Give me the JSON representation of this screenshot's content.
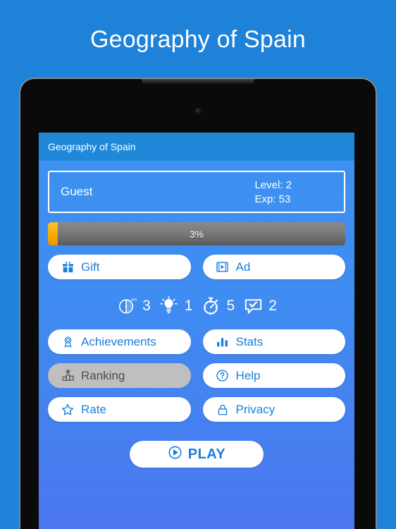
{
  "banner": {
    "title": "Geography of Spain"
  },
  "device": {
    "camera_icon": "camera-dot",
    "speaker_icon": "speaker-notch"
  },
  "app": {
    "appbar": {
      "title": "Geography of Spain"
    },
    "profile": {
      "name": "Guest",
      "level": "Level: 2",
      "exp": "Exp: 53"
    },
    "progress": {
      "label": "3%",
      "percent": 3,
      "fill_color": "#f5a800",
      "track_color": "#7a7a7a"
    },
    "rows": [
      {
        "buttons": [
          {
            "label": "Gift",
            "icon": "gift-icon",
            "disabled": false
          },
          {
            "label": "Ad",
            "icon": "video-ad-icon",
            "disabled": false
          }
        ]
      }
    ],
    "powerups": [
      {
        "icon": "fifty-fifty-icon",
        "count": "3"
      },
      {
        "icon": "lightbulb-icon",
        "count": "1"
      },
      {
        "icon": "stopwatch-icon",
        "count": "5"
      },
      {
        "icon": "answer-bubble-icon",
        "count": "2"
      }
    ],
    "menu": [
      {
        "label": "Achievements",
        "icon": "award-icon",
        "disabled": false
      },
      {
        "label": "Stats",
        "icon": "bar-chart-icon",
        "disabled": false
      },
      {
        "label": "Ranking",
        "icon": "podium-icon",
        "disabled": true
      },
      {
        "label": "Help",
        "icon": "question-circle-icon",
        "disabled": false
      },
      {
        "label": "Rate",
        "icon": "star-icon",
        "disabled": false
      },
      {
        "label": "Privacy",
        "icon": "lock-icon",
        "disabled": false
      }
    ],
    "play": {
      "label": "PLAY",
      "icon": "play-circle-icon"
    },
    "colors": {
      "accent": "#1a7fdc",
      "appbar": "#1f88d9",
      "page_bg": "#1d82d8"
    }
  }
}
